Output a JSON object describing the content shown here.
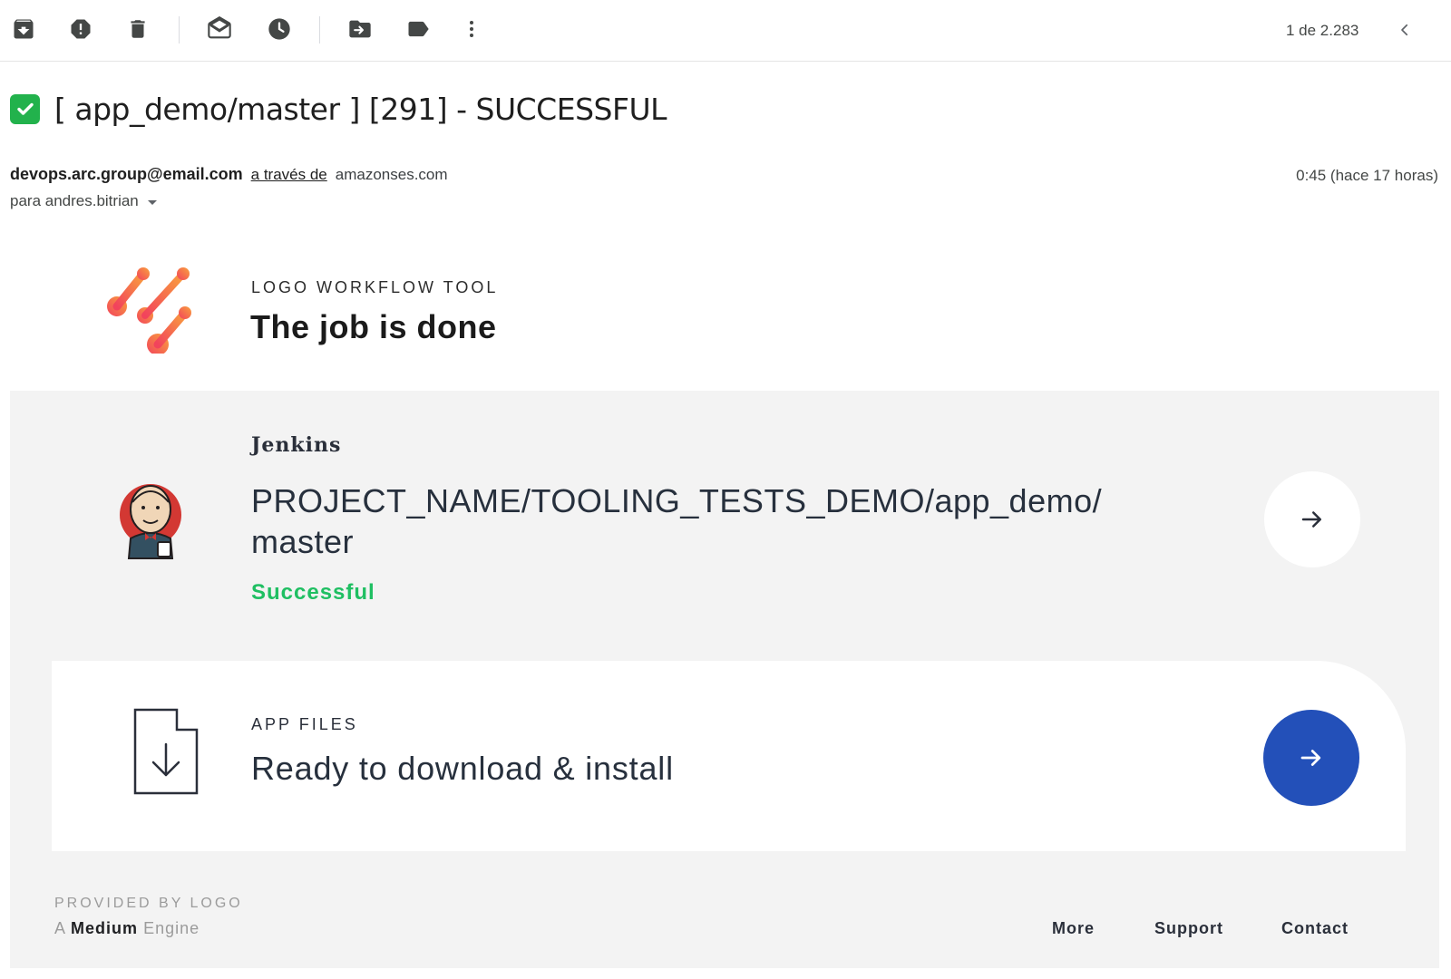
{
  "toolbar": {
    "icons": [
      "archive-icon",
      "report-spam-icon",
      "delete-icon",
      "mark-unread-icon",
      "snooze-icon",
      "move-to-icon",
      "label-icon",
      "more-icon"
    ],
    "pager_text": "1 de 2.283"
  },
  "email": {
    "subject_emoji": "check-mark-button",
    "subject": "[ app_demo/master ] [291] - SUCCESSFUL",
    "sender_email": "devops.arc.group@email.com",
    "via_label": "a través de",
    "via_domain": "amazonses.com",
    "date": "0:45 (hace 17 horas)",
    "recipient": "para andres.bitrian"
  },
  "body": {
    "brand_label": "LOGO WORKFLOW TOOL",
    "brand_title": "The job is done",
    "jenkins": {
      "name": "Jenkins",
      "project_path_line1": "PROJECT_NAME/TOOLING_TESTS_DEMO/app_demo/",
      "project_path_line2": "master",
      "status": "Successful"
    },
    "files": {
      "label": "APP FILES",
      "title": "Ready to download & install"
    },
    "footer": {
      "provided_by": "PROVIDED BY LOGO",
      "engine_prefix": "A",
      "engine_bold": "Medium",
      "engine_suffix": "Engine",
      "links": [
        "More",
        "Support",
        "Contact"
      ]
    }
  },
  "colors": {
    "success_green": "#1fbf62",
    "accent_blue": "#2350b9",
    "panel_gray": "#f3f3f3"
  }
}
